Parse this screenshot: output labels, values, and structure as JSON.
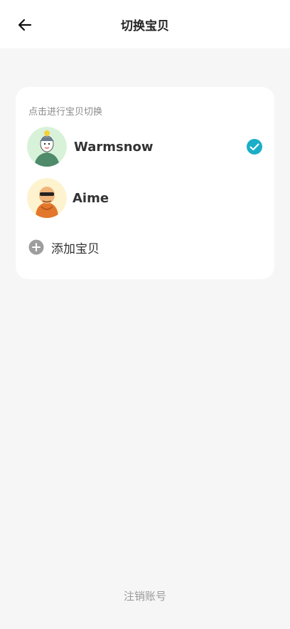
{
  "header": {
    "title": "切换宝贝",
    "back_icon": "arrow-left-icon"
  },
  "card": {
    "hint": "点击进行宝贝切换",
    "babies": [
      {
        "name": "Warmsnow",
        "selected": true
      },
      {
        "name": "Aime",
        "selected": false
      }
    ],
    "add_label": "添加宝贝"
  },
  "footer": {
    "logout_label": "注销账号"
  },
  "colors": {
    "accent": "#1aaec7",
    "add_icon": "#9e9e9e"
  }
}
